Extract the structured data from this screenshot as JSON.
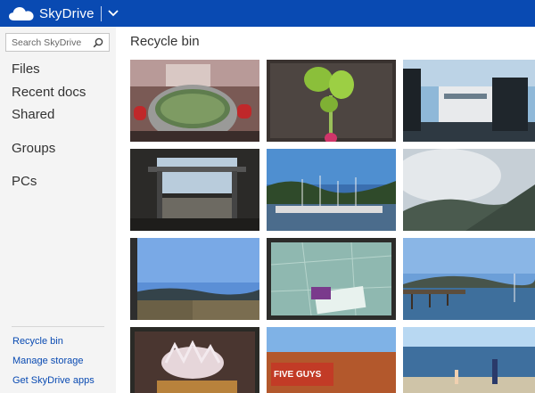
{
  "header": {
    "brand": "SkyDrive",
    "brand_color": "#094ab2",
    "logo_icon": "cloud-icon",
    "menu_icon": "chevron-down-icon"
  },
  "search": {
    "placeholder": "Search SkyDrive",
    "value": "",
    "icon": "search-icon"
  },
  "nav": {
    "items": [
      "Files",
      "Recent docs",
      "Shared",
      "Groups",
      "PCs"
    ]
  },
  "bottom_links": [
    "Recycle bin",
    "Manage storage",
    "Get SkyDrive apps"
  ],
  "main": {
    "title": "Recycle bin"
  },
  "photos": {
    "row4_sign_text": "FIVE GUYS"
  }
}
